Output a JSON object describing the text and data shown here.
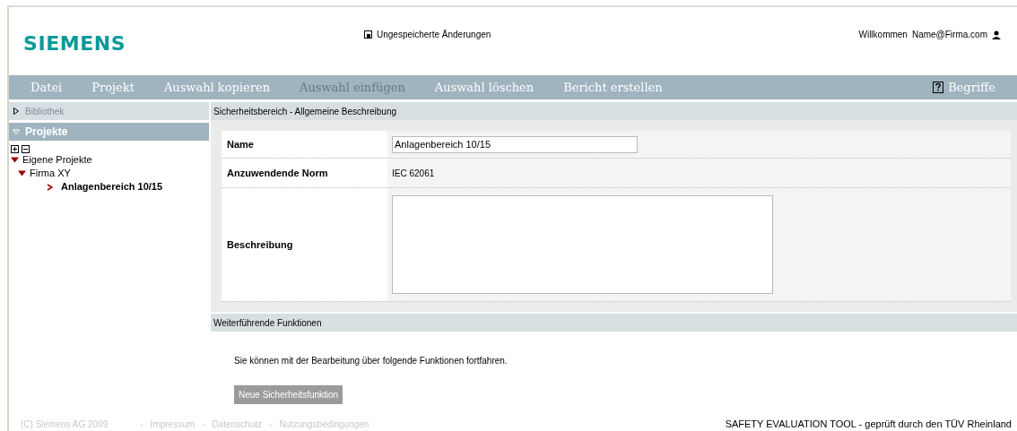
{
  "header": {
    "logo": "SIEMENS",
    "unsaved_notice": "Ungespeicherte Änderungen",
    "welcome": "Willkommen",
    "user": "Name@Firma.com"
  },
  "menu": {
    "items": [
      {
        "label": "Datei",
        "disabled": false
      },
      {
        "label": "Projekt",
        "disabled": false
      },
      {
        "label": "Auswahl kopieren",
        "disabled": false
      },
      {
        "label": "Auswahl einfügen",
        "disabled": true
      },
      {
        "label": "Auswahl löschen",
        "disabled": false
      },
      {
        "label": "Bericht erstellen",
        "disabled": false
      }
    ],
    "help": "Begriffe"
  },
  "sidebar": {
    "sections": [
      {
        "title": "Bibliothek",
        "expanded": false
      },
      {
        "title": "Projekte",
        "expanded": true
      }
    ],
    "tree": [
      {
        "label": "Eigene Projekte",
        "expanded": true,
        "selected": false,
        "children": [
          {
            "label": "Firma XY",
            "expanded": true,
            "selected": false,
            "children": [
              {
                "label": "Anlagenbereich 10/15",
                "selected": true
              }
            ]
          }
        ]
      }
    ]
  },
  "main": {
    "section_title": "Sicherheitsbereich - Allgemeine Beschreibung",
    "fields": [
      {
        "kind": "input",
        "label": "Name",
        "value": "Anlagenbereich 10/15"
      },
      {
        "kind": "text",
        "label": "Anzuwendende Norm",
        "value": "IEC 62061"
      },
      {
        "kind": "textarea",
        "label": "Beschreibung"
      }
    ],
    "further_title": "Weiterführende Funktionen",
    "further_text": "Sie können mit der Bearbeitung über folgende Funktionen fortfahren.",
    "further_button": "Neue Sicherheitsfunktion"
  },
  "footer": {
    "copyright": "(C) Siemens AG 2009",
    "links": [
      "Impressum",
      "Datenschutz",
      "Nutzungsbedingungen"
    ],
    "separator": "-",
    "tagline": "SAFETY EVALUATION TOOL - geprüft durch den TÜV Rheinland"
  }
}
